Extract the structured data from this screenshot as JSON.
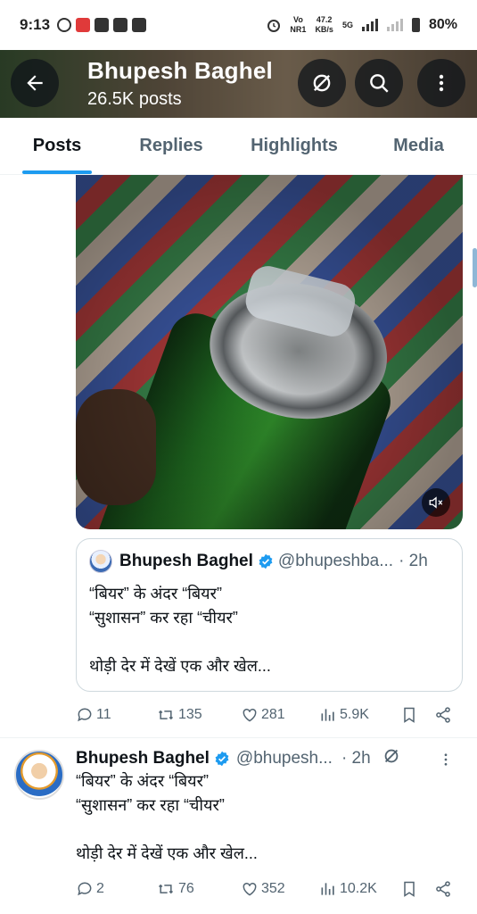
{
  "status_bar": {
    "time": "9:13",
    "network_top": "Vo",
    "network_bottom": "NR1",
    "speed_top": "47.2",
    "speed_bottom": "KB/s",
    "network_type": "5G",
    "battery": "80%"
  },
  "header": {
    "title": "Bhupesh Baghel",
    "posts_count": "26.5K posts"
  },
  "tabs": [
    {
      "label": "Posts",
      "active": true
    },
    {
      "label": "Replies",
      "active": false
    },
    {
      "label": "Highlights",
      "active": false
    },
    {
      "label": "Media",
      "active": false
    }
  ],
  "quote": {
    "name": "Bhupesh Baghel",
    "handle": "@bhupeshba...",
    "time": "· 2h",
    "text": "“बियर” के अंदर “बियर”\n“सुशासन” कर रहा “चीयर”\n\nथोड़ी देर में देखें एक और खेल..."
  },
  "tweet1_actions": {
    "replies": "11",
    "reposts": "135",
    "likes": "281",
    "views": "5.9K"
  },
  "tweet2": {
    "name": "Bhupesh Baghel",
    "handle": "@bhupesh...",
    "time": "· 2h",
    "text": "“बियर” के अंदर “बियर”\n“सुशासन” कर रहा “चीयर”\n\nथोड़ी देर में देखें एक और खेल...",
    "replies": "2",
    "reposts": "76",
    "likes": "352",
    "views": "10.2K"
  },
  "colors": {
    "accent": "#1d9bf0",
    "secondary_text": "#536471"
  }
}
